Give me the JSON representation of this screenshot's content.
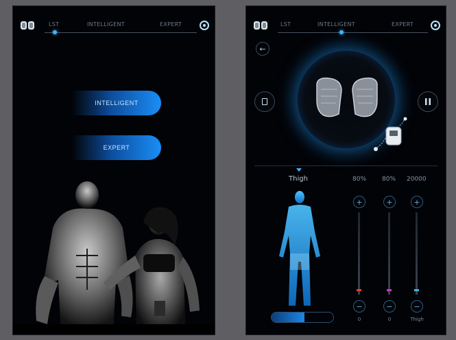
{
  "screen1": {
    "header": {
      "tabs": [
        {
          "label": "LST"
        },
        {
          "label": "INTELLIGENT"
        },
        {
          "label": "EXPERT"
        }
      ]
    },
    "buttons": {
      "intelligent_label": "INTELLIGENT",
      "expert_label": "EXPERT"
    }
  },
  "screen2": {
    "header": {
      "tabs": [
        {
          "label": "LST"
        },
        {
          "label": "INTELLIGENT"
        },
        {
          "label": "EXPERT"
        }
      ]
    },
    "body_area_label": "Thigh",
    "channels": [
      {
        "value": "80%",
        "label": "0"
      },
      {
        "value": "80%",
        "label": "0"
      },
      {
        "value": "20000",
        "label": "Thigh"
      }
    ],
    "colors": {
      "accent": "#1a8ef5",
      "glow": "#3fb5ff",
      "knob1": "#e0452f",
      "knob2": "#c43cc7",
      "knob3": "#3fb5ff"
    }
  }
}
